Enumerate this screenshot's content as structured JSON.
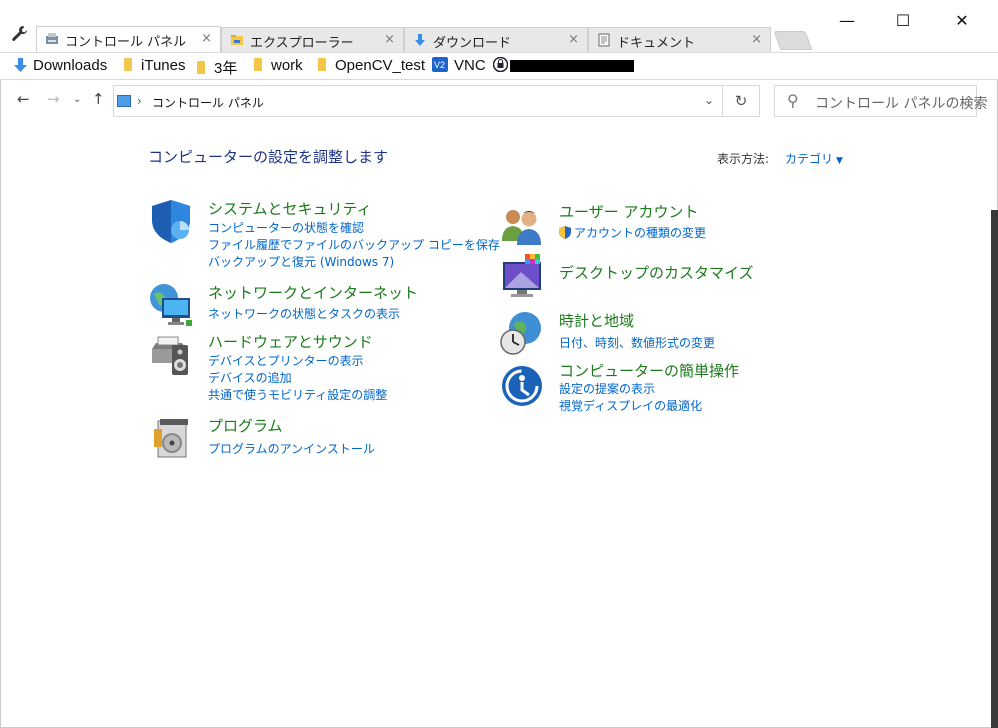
{
  "tabs": [
    {
      "label": "コントロール パネル",
      "active": true,
      "icon": "control-panel-icon"
    },
    {
      "label": "エクスプローラー",
      "active": false,
      "icon": "explorer-folder-icon"
    },
    {
      "label": "ダウンロード",
      "active": false,
      "icon": "download-arrow-icon"
    },
    {
      "label": "ドキュメント",
      "active": false,
      "icon": "document-icon"
    }
  ],
  "window_controls": {
    "minimize": "—",
    "maximize": "☐",
    "close": "✕"
  },
  "bookmarks": [
    {
      "label": "Downloads",
      "icon": "download-arrow-icon"
    },
    {
      "label": "iTunes",
      "icon": "folder-icon"
    },
    {
      "label": "3年",
      "icon": "folder-icon"
    },
    {
      "label": "work",
      "icon": "folder-icon"
    },
    {
      "label": "OpenCV_test",
      "icon": "folder-icon"
    },
    {
      "label": "VNC",
      "icon": "vnc-icon"
    }
  ],
  "address": {
    "crumb": "コントロール パネル",
    "search_placeholder": "コントロール パネルの検索"
  },
  "main": {
    "heading": "コンピューターの設定を調整します",
    "view_by_label": "表示方法:",
    "view_by_value": "カテゴリ"
  },
  "categories": [
    {
      "title": "システムとセキュリティ",
      "icon": "system-security-icon",
      "links": [
        "コンピューターの状態を確認",
        "ファイル履歴でファイルのバックアップ コピーを保存",
        "バックアップと復元 (Windows 7)"
      ]
    },
    {
      "title": "ネットワークとインターネット",
      "icon": "network-internet-icon",
      "links": [
        "ネットワークの状態とタスクの表示"
      ]
    },
    {
      "title": "ハードウェアとサウンド",
      "icon": "hardware-sound-icon",
      "links": [
        "デバイスとプリンターの表示",
        "デバイスの追加",
        "共通で使うモビリティ設定の調整"
      ]
    },
    {
      "title": "プログラム",
      "icon": "programs-icon",
      "links": [
        "プログラムのアンインストール"
      ]
    },
    {
      "title": "ユーザー アカウント",
      "icon": "user-accounts-icon",
      "links": [
        "アカウントの種類の変更"
      ]
    },
    {
      "title": "デスクトップのカスタマイズ",
      "icon": "desktop-customize-icon",
      "links": []
    },
    {
      "title": "時計と地域",
      "icon": "clock-region-icon",
      "links": [
        "日付、時刻、数値形式の変更"
      ]
    },
    {
      "title": "コンピューターの簡単操作",
      "icon": "ease-of-access-icon",
      "links": [
        "設定の提案の表示",
        "視覚ディスプレイの最適化"
      ]
    }
  ]
}
